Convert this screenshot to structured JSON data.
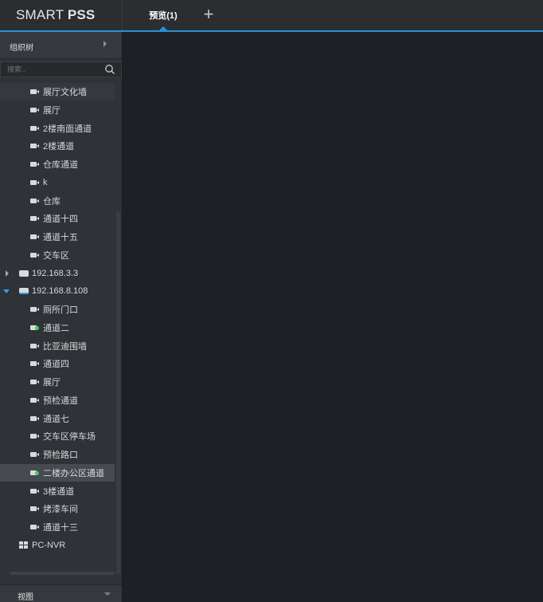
{
  "app": {
    "logo_light": "SMART ",
    "logo_bold": "PSS"
  },
  "tabs": [
    {
      "label": "预览(1)",
      "active": true
    }
  ],
  "add_tab_symbol": "+",
  "sidebar": {
    "header": "组织树",
    "search_placeholder": "搜索..",
    "tree": [
      {
        "label": "展厅文化墙",
        "type": "camera",
        "status": "normal",
        "level": 1,
        "style": "partial"
      },
      {
        "label": "展厅",
        "type": "camera",
        "status": "normal",
        "level": 1
      },
      {
        "label": "2楼南面通道",
        "type": "camera",
        "status": "normal",
        "level": 1
      },
      {
        "label": "2楼通道",
        "type": "camera",
        "status": "normal",
        "level": 1
      },
      {
        "label": "仓库通道",
        "type": "camera",
        "status": "normal",
        "level": 1
      },
      {
        "label": "k",
        "type": "camera",
        "status": "normal",
        "level": 1
      },
      {
        "label": "仓库",
        "type": "camera",
        "status": "normal",
        "level": 1
      },
      {
        "label": "通道十四",
        "type": "camera",
        "status": "normal",
        "level": 1
      },
      {
        "label": "通道十五",
        "type": "camera",
        "status": "normal",
        "level": 1
      },
      {
        "label": "交车区",
        "type": "camera",
        "status": "normal",
        "level": 1
      },
      {
        "label": "192.168.3.3",
        "type": "device",
        "expanded": false,
        "level": 0
      },
      {
        "label": "192.168.8.108",
        "type": "device",
        "expanded": true,
        "level": 0
      },
      {
        "label": "厕所门口",
        "type": "camera",
        "status": "normal",
        "level": 1
      },
      {
        "label": "通道二",
        "type": "camera",
        "status": "live",
        "level": 1
      },
      {
        "label": "比亚迪围墙",
        "type": "camera",
        "status": "normal",
        "level": 1
      },
      {
        "label": "通道四",
        "type": "camera",
        "status": "normal",
        "level": 1
      },
      {
        "label": "展厅",
        "type": "camera",
        "status": "normal",
        "level": 1
      },
      {
        "label": "预检通道",
        "type": "camera",
        "status": "normal",
        "level": 1
      },
      {
        "label": "通道七",
        "type": "camera",
        "status": "normal",
        "level": 1
      },
      {
        "label": "交车区停车场",
        "type": "camera",
        "status": "normal",
        "level": 1
      },
      {
        "label": "预检路口",
        "type": "camera",
        "status": "normal",
        "level": 1
      },
      {
        "label": "二楼办公区通道",
        "type": "camera",
        "status": "live",
        "level": 1,
        "style": "selected"
      },
      {
        "label": "3楼通道",
        "type": "camera",
        "status": "normal",
        "level": 1
      },
      {
        "label": "烤漆车间",
        "type": "camera",
        "status": "normal",
        "level": 1
      },
      {
        "label": "通道十三",
        "type": "camera",
        "status": "normal",
        "level": 1
      },
      {
        "label": "PC-NVR",
        "type": "nvr",
        "level": 0
      }
    ],
    "footer": "视图"
  },
  "colors": {
    "accent": "#2a90d8",
    "live": "#3fd14b",
    "bg": "#1d2024",
    "panel": "#2f3236"
  }
}
